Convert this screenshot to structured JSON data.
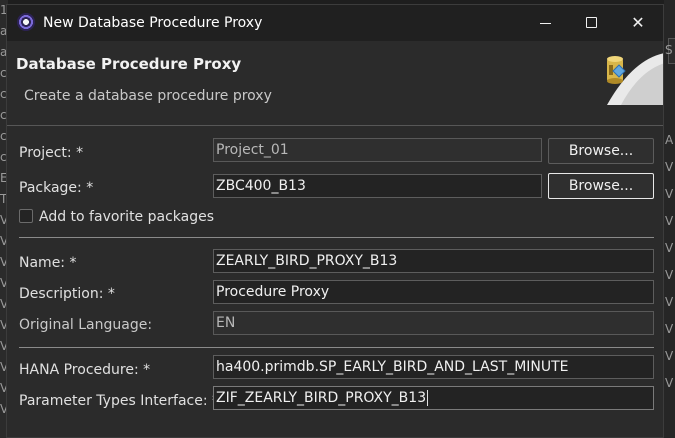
{
  "background": {
    "left_fragments": [
      "12",
      "a",
      "a",
      "c",
      "c",
      "c",
      "c",
      "c",
      "E",
      "T",
      "V",
      "V",
      "V",
      "V",
      "V",
      "V",
      "V",
      "V",
      "V",
      "V"
    ],
    "right_fragments": [
      "S",
      "A",
      "V",
      "V",
      "V",
      "V",
      "V",
      "V",
      "V",
      "V",
      "V"
    ]
  },
  "window": {
    "title": "New Database Procedure Proxy",
    "minimize_symbol": "—",
    "maximize_symbol": "☐",
    "close_symbol": "✕"
  },
  "banner": {
    "title": "Database Procedure Proxy",
    "subtitle": "Create a database procedure proxy"
  },
  "form": {
    "project": {
      "label": "Project: *",
      "value": "Project_01",
      "button": "Browse..."
    },
    "package": {
      "label": "Package: *",
      "value": "ZBC400_B13",
      "button": "Browse..."
    },
    "favorite": {
      "label": "Add to favorite packages",
      "checked": false
    },
    "name": {
      "label": "Name: *",
      "value": "ZEARLY_BIRD_PROXY_B13"
    },
    "description": {
      "label": "Description: *",
      "value": "Procedure Proxy"
    },
    "language": {
      "label": "Original Language:",
      "value": "EN"
    },
    "hana_procedure": {
      "label": "HANA Procedure: *",
      "value": "ha400.primdb.SP_EARLY_BIRD_AND_LAST_MINUTE"
    },
    "param_interface": {
      "label": "Parameter Types Interface: *",
      "value": "ZIF_ZEARLY_BIRD_PROXY_B13"
    }
  },
  "icons": {
    "app": "eclipse-icon",
    "banner": "database-procedure-wizard-icon"
  }
}
